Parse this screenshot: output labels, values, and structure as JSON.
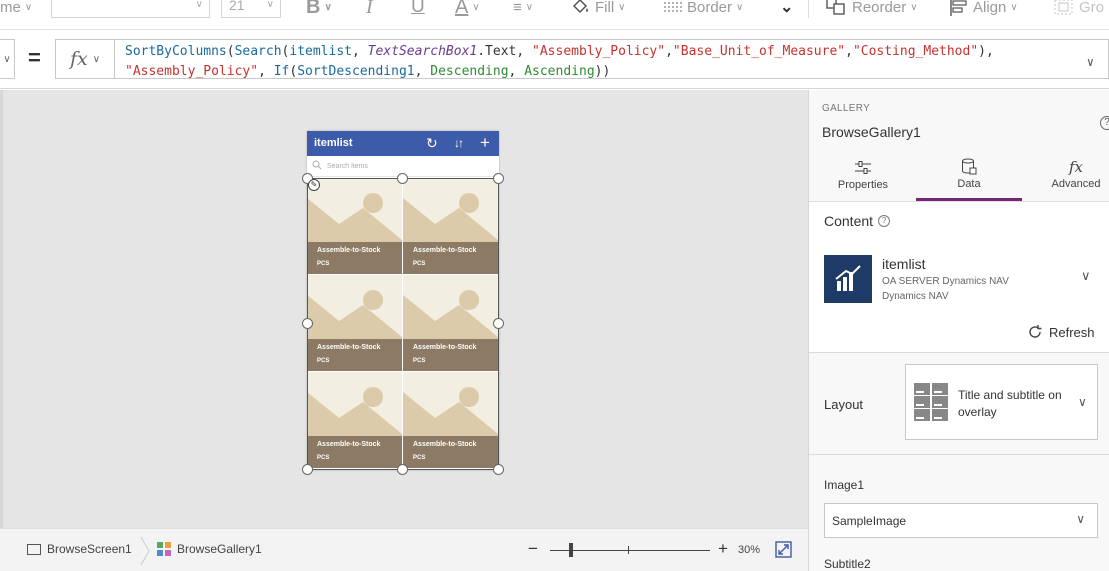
{
  "ribbon": {
    "name_partial": "me",
    "font_size": "21",
    "bold": "B",
    "italic": "I",
    "underline": "U",
    "font_color_glyph": "A",
    "fill_label": "Fill",
    "border_label": "Border",
    "reorder_label": "Reorder",
    "align_label": "Align",
    "group_label": "Gro"
  },
  "formula_bar": {
    "equals": "=",
    "fx": "fx",
    "line1": [
      {
        "t": "SortByColumns",
        "c": "fn"
      },
      {
        "t": "(",
        "c": ""
      },
      {
        "t": "Search",
        "c": "fn"
      },
      {
        "t": "(",
        "c": ""
      },
      {
        "t": "itemlist",
        "c": "fn"
      },
      {
        "t": ", ",
        "c": ""
      },
      {
        "t": "TextSearchBox1",
        "c": "ctl"
      },
      {
        "t": ".Text, ",
        "c": ""
      },
      {
        "t": "\"Assembly_Policy\"",
        "c": "str"
      },
      {
        "t": ",",
        "c": ""
      },
      {
        "t": "\"Base_Unit_of_Measure\"",
        "c": "str"
      },
      {
        "t": ",",
        "c": ""
      },
      {
        "t": "\"Costing_Method\"",
        "c": "str"
      },
      {
        "t": "),",
        "c": ""
      }
    ],
    "line2": [
      {
        "t": "\"Assembly_Policy\"",
        "c": "str"
      },
      {
        "t": ", ",
        "c": ""
      },
      {
        "t": "If",
        "c": "fn"
      },
      {
        "t": "(",
        "c": ""
      },
      {
        "t": "SortDescending1",
        "c": "fn"
      },
      {
        "t": ", ",
        "c": ""
      },
      {
        "t": "Descending",
        "c": "en"
      },
      {
        "t": ", ",
        "c": ""
      },
      {
        "t": "Ascending",
        "c": "en"
      },
      {
        "t": "))",
        "c": ""
      }
    ]
  },
  "phone": {
    "title": "itemlist",
    "search_placeholder": "Search items",
    "items": [
      {
        "title": "Assemble-to-Stock",
        "subtitle": "PCS"
      },
      {
        "title": "Assemble-to-Stock",
        "subtitle": "PCS"
      },
      {
        "title": "Assemble-to-Stock",
        "subtitle": "PCS"
      },
      {
        "title": "Assemble-to-Stock",
        "subtitle": "PCS"
      },
      {
        "title": "Assemble-to-Stock",
        "subtitle": "PCS"
      },
      {
        "title": "Assemble-to-Stock",
        "subtitle": "PCS"
      }
    ]
  },
  "statusbar": {
    "screen": "BrowseScreen1",
    "control": "BrowseGallery1",
    "zoom": "30%",
    "zoom_level_percent": 30,
    "minus": "−",
    "plus": "+"
  },
  "panel": {
    "kind": "GALLERY",
    "name": "BrowseGallery1",
    "tabs": [
      {
        "label": "Properties",
        "icon": "sliders-icon"
      },
      {
        "label": "Data",
        "icon": "database-icon"
      },
      {
        "label": "Advanced",
        "icon": "fx-icon"
      }
    ],
    "active_tab": "Data",
    "content_label": "Content",
    "datasource": {
      "name": "itemlist",
      "line1": "OA SERVER Dynamics NAV",
      "line2": "Dynamics NAV"
    },
    "refresh_label": "Refresh",
    "layout_label": "Layout",
    "layout_value": "Title and subtitle on overlay",
    "image_label": "Image1",
    "image_value": "SampleImage",
    "subtitle_label": "Subtitle2"
  },
  "colors": {
    "header_blue": "#3c5ba8",
    "overlay_brown": "#8d7a64",
    "accent_purple": "#742774",
    "datasource_navy": "#1e3a66"
  }
}
